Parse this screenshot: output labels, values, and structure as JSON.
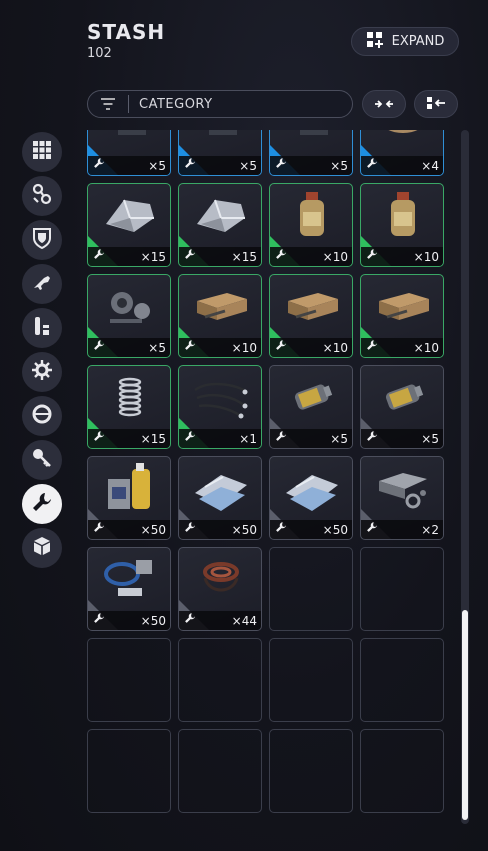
{
  "header": {
    "title": "STASH",
    "count": "102",
    "expand_label": "EXPAND"
  },
  "filter": {
    "label": "CATEGORY"
  },
  "sidebar": {
    "items": [
      {
        "name": "all-items",
        "icon": "grid-icon",
        "active": false
      },
      {
        "name": "augments",
        "icon": "augment-icon",
        "active": false
      },
      {
        "name": "shields",
        "icon": "shield-icon",
        "active": false
      },
      {
        "name": "weapons",
        "icon": "gun-icon",
        "active": false
      },
      {
        "name": "ammo",
        "icon": "ammo-icon",
        "active": false
      },
      {
        "name": "mods",
        "icon": "gear-icon",
        "active": false
      },
      {
        "name": "quick-use",
        "icon": "ring-icon",
        "active": false
      },
      {
        "name": "keys",
        "icon": "key-icon",
        "active": false
      },
      {
        "name": "materials",
        "icon": "wrench-icon",
        "active": true
      },
      {
        "name": "misc",
        "icon": "box-icon",
        "active": false
      }
    ]
  },
  "grid": {
    "items": [
      {
        "art": "mechanical-parts",
        "qty": "×5",
        "rarity": "blue"
      },
      {
        "art": "mechanical-parts",
        "qty": "×5",
        "rarity": "blue"
      },
      {
        "art": "mechanical-parts",
        "qty": "×5",
        "rarity": "blue"
      },
      {
        "art": "disc",
        "qty": "×4",
        "rarity": "blue"
      },
      {
        "art": "metal-casing",
        "qty": "×15",
        "rarity": "green"
      },
      {
        "art": "metal-casing",
        "qty": "×15",
        "rarity": "green"
      },
      {
        "art": "chemical-jar",
        "qty": "×10",
        "rarity": "green"
      },
      {
        "art": "chemical-jar",
        "qty": "×10",
        "rarity": "green"
      },
      {
        "art": "gear-parts",
        "qty": "×5",
        "rarity": "green"
      },
      {
        "art": "device-box",
        "qty": "×10",
        "rarity": "green"
      },
      {
        "art": "device-box",
        "qty": "×10",
        "rarity": "green"
      },
      {
        "art": "device-box",
        "qty": "×10",
        "rarity": "green"
      },
      {
        "art": "spring",
        "qty": "×15",
        "rarity": "green"
      },
      {
        "art": "wires",
        "qty": "×1",
        "rarity": "green"
      },
      {
        "art": "canister",
        "qty": "×5",
        "rarity": "grey"
      },
      {
        "art": "canister",
        "qty": "×5",
        "rarity": "grey"
      },
      {
        "art": "oil-bottles",
        "qty": "×50",
        "rarity": "grey"
      },
      {
        "art": "fabric",
        "qty": "×50",
        "rarity": "grey"
      },
      {
        "art": "fabric",
        "qty": "×50",
        "rarity": "grey"
      },
      {
        "art": "metal-bracket",
        "qty": "×2",
        "rarity": "grey"
      },
      {
        "art": "hose-parts",
        "qty": "×50",
        "rarity": "grey"
      },
      {
        "art": "rubber-coil",
        "qty": "×44",
        "rarity": "grey"
      }
    ],
    "empty_slots": 10
  },
  "scrollbar": {
    "position_fraction": 0.82
  }
}
